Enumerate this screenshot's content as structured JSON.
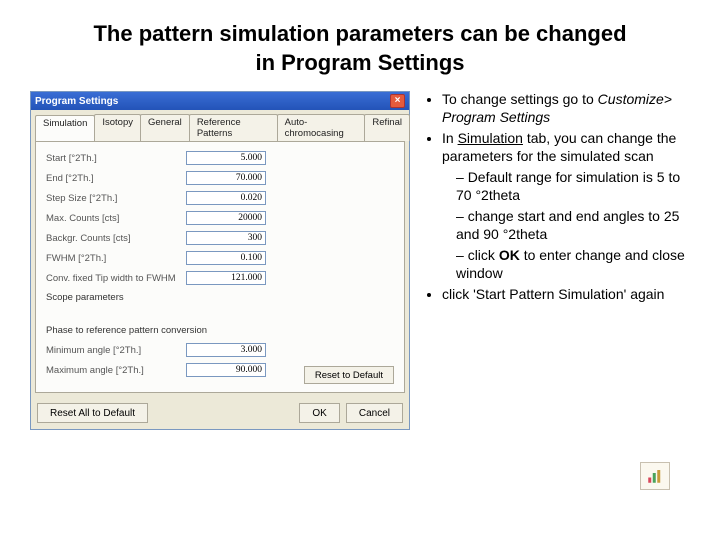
{
  "title_line1": "The pattern simulation parameters can be changed",
  "title_line2": "in Program Settings",
  "bullets": {
    "b1a": "To change settings go to ",
    "b1b": "Customize> Program Settings",
    "b2a": "In ",
    "b2b": "Simulation",
    "b2c": " tab, you can change the parameters for the simulated scan",
    "s1": "Default range for simulation is 5 to 70 °2theta",
    "s2": "change start and end angles to 25 and 90 °2theta",
    "s3a": "click ",
    "s3b": "OK",
    "s3c": " to enter change and close window",
    "b3": "click 'Start Pattern Simulation' again"
  },
  "dialog": {
    "title": "Program Settings",
    "tabs": [
      "Simulation",
      "Isotopy",
      "General",
      "Reference Patterns",
      "Auto-chromocasing",
      "Refinal"
    ],
    "fields": [
      {
        "label": "Start [°2Th.]",
        "value": "5.000"
      },
      {
        "label": "End [°2Th.]",
        "value": "70.000"
      },
      {
        "label": "Step Size [°2Th.]",
        "value": "0.020"
      },
      {
        "label": "Max. Counts [cts]",
        "value": "20000"
      },
      {
        "label": "Backgr. Counts [cts]",
        "value": "300"
      },
      {
        "label": "FWHM [°2Th.]",
        "value": "0.100"
      },
      {
        "label": "Conv. fixed Tip width to FWHM",
        "value": "121.000"
      }
    ],
    "heading1": "Scope parameters",
    "heading2": "Phase to reference pattern conversion",
    "fields2": [
      {
        "label": "Minimum angle [°2Th.]",
        "value": "3.000"
      },
      {
        "label": "Maximum angle [°2Th.]",
        "value": "90.000"
      }
    ],
    "reset_tab": "Reset to Default",
    "reset_all": "Reset All to Default",
    "ok": "OK",
    "cancel": "Cancel"
  }
}
